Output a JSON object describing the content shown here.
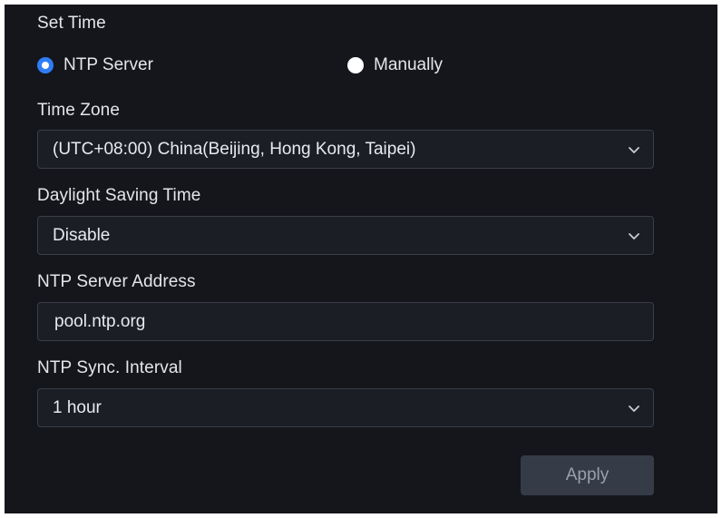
{
  "set_time": {
    "label": "Set Time",
    "options": [
      {
        "label": "NTP Server",
        "selected": true
      },
      {
        "label": "Manually",
        "selected": false
      }
    ]
  },
  "time_zone": {
    "label": "Time Zone",
    "value": "(UTC+08:00) China(Beijing, Hong Kong, Taipei)"
  },
  "daylight_saving": {
    "label": "Daylight Saving Time",
    "value": "Disable"
  },
  "ntp_server_address": {
    "label": "NTP Server Address",
    "value": "pool.ntp.org"
  },
  "ntp_sync_interval": {
    "label": "NTP Sync. Interval",
    "value": "1 hour"
  },
  "apply_label": "Apply",
  "colors": {
    "background": "#14161c",
    "field_background": "#1b1e25",
    "field_border": "#3a3e47",
    "accent": "#2f7df6",
    "button_background": "#363c47",
    "button_text": "#9aa0ab"
  }
}
